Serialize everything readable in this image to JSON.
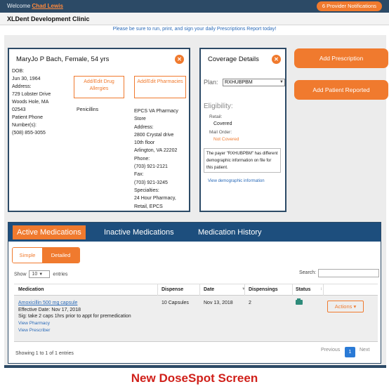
{
  "topbar": {
    "welcome_prefix": "Welcome",
    "user_name": "Chad Lewis",
    "notifications": "6 Provider Notifications"
  },
  "clinic": {
    "name": "XLDent Development Clinic",
    "reminder": "Please be sure to run, print, and sign your daily Prescriptions Report today!"
  },
  "patient": {
    "header": "MaryJo P Bach, Female, 54 yrs",
    "dob_label": "DOB:",
    "dob": "Jun 30, 1964",
    "address_label": "Address:",
    "address_line1": "729 Lobster Drive",
    "address_line2": "Woods Hole, MA",
    "zip": "02543",
    "phone_label_1": "Patient Phone",
    "phone_label_2": "Number(s):",
    "phone": "(508) 855-3055",
    "allergy_button": "Add/Edit Drug Allergies",
    "pharmacy_button": "Add/Edit Pharmacies",
    "allergy": "Penicillins",
    "pharmacy": {
      "name_1": "EPCS VA Pharmacy",
      "name_2": "Store",
      "address_label": "Address:",
      "address_1": "2800 Crystal drive",
      "address_2": "10th floor",
      "address_3": "Arlington,  VA 22202",
      "phone_label": "Phone:",
      "phone": "(703) 921-2121",
      "fax_label": "Fax:",
      "fax": "(703) 921-3245",
      "specialties_label": "Specialties:",
      "specialties_1": "24 Hour Pharmacy,",
      "specialties_2": "Retail, EPCS"
    }
  },
  "coverage": {
    "title": "Coverage Details",
    "plan_label": "Plan:",
    "plan_value": "RXHUBPBM",
    "eligibility_label": "Eligibility:",
    "retail_label": "Retail:",
    "retail_value": "Covered",
    "mail_label": "Mail Order:",
    "mail_value": "Not Covered",
    "payer_note": "The payer \"RXHUBPBM\" has different demographic information on file for this patient.",
    "demo_link": "View demographic information"
  },
  "actions": {
    "add_prescription": "Add Prescription",
    "add_patient_reported": "Add Patient Reported"
  },
  "med_tabs": {
    "active": "Active Medications",
    "inactive": "Inactive Medications",
    "history": "Medication History"
  },
  "view_toggle": {
    "simple": "Simple",
    "detailed": "Detailed"
  },
  "table_controls": {
    "show": "Show",
    "entries_value": "10",
    "entries": "entries",
    "search": "Search:"
  },
  "table": {
    "headers": [
      "Medication",
      "Dispense",
      "Date",
      "Dispensings",
      "Status"
    ],
    "row": {
      "medication": "Amoxicillin 500 mg capsule",
      "effective": "Effective Date: Nov 17, 2018",
      "sig": "Sig: take 2 caps 1hrs prior to appt for premedication",
      "view_pharmacy": "View Pharmacy",
      "view_prescriber": "View Prescriber",
      "dispense": "10 Capsules",
      "date": "Nov 13, 2018",
      "dispensings": "2",
      "actions": "Actions ▾"
    }
  },
  "footer": {
    "showing": "Showing 1 to 1 of 1 entries",
    "previous": "Previous",
    "page": "1",
    "next": "Next"
  },
  "caption": "New DoseSpot Screen",
  "colors": {
    "accent": "#f07a2e",
    "navy": "#2c4a66",
    "tab_blue": "#1d4e7d",
    "link": "#2a6ab8",
    "caption_red": "#d0201a"
  }
}
